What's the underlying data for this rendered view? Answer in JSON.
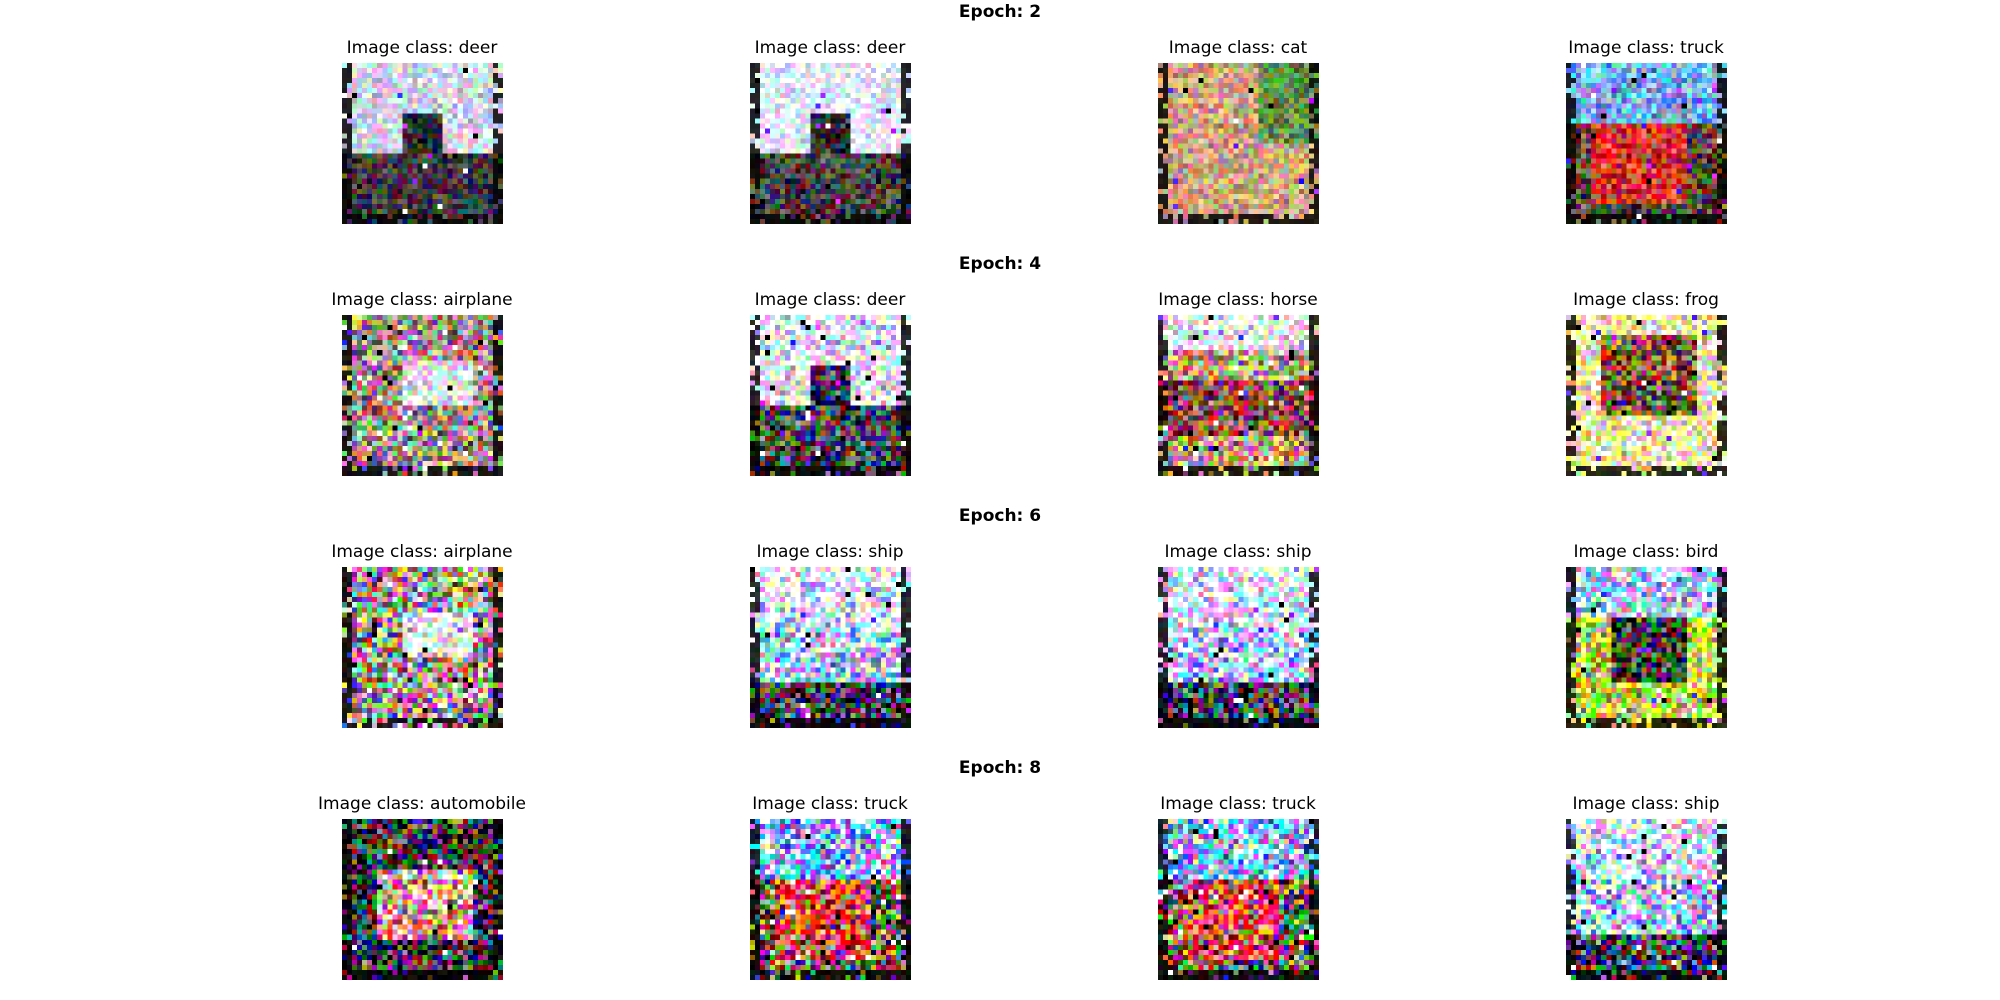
{
  "rows": [
    {
      "title": "Epoch: 2",
      "items": [
        {
          "label": "Image class: deer",
          "scene": "deer",
          "brightness": 0.55,
          "saturation": 0.45
        },
        {
          "label": "Image class: deer",
          "scene": "deer",
          "brightness": 0.7,
          "saturation": 0.45
        },
        {
          "label": "Image class: cat",
          "scene": "cat",
          "brightness": 0.6,
          "saturation": 0.45
        },
        {
          "label": "Image class: truck",
          "scene": "truck",
          "brightness": 0.6,
          "saturation": 0.6
        }
      ]
    },
    {
      "title": "Epoch: 4",
      "items": [
        {
          "label": "Image class: airplane",
          "scene": "airplane",
          "brightness": 0.6,
          "saturation": 0.75
        },
        {
          "label": "Image class: deer",
          "scene": "deer",
          "brightness": 0.75,
          "saturation": 0.75
        },
        {
          "label": "Image class: horse",
          "scene": "horse",
          "brightness": 0.65,
          "saturation": 0.75
        },
        {
          "label": "Image class: frog",
          "scene": "frog",
          "brightness": 0.7,
          "saturation": 0.75
        }
      ]
    },
    {
      "title": "Epoch: 6",
      "items": [
        {
          "label": "Image class: airplane",
          "scene": "airplane",
          "brightness": 0.65,
          "saturation": 0.9
        },
        {
          "label": "Image class: ship",
          "scene": "ship",
          "brightness": 0.75,
          "saturation": 0.9
        },
        {
          "label": "Image class: ship",
          "scene": "ship",
          "brightness": 0.75,
          "saturation": 0.9
        },
        {
          "label": "Image class: bird",
          "scene": "bird",
          "brightness": 0.7,
          "saturation": 0.9
        }
      ]
    },
    {
      "title": "Epoch: 8",
      "items": [
        {
          "label": "Image class: automobile",
          "scene": "automobile",
          "brightness": 0.6,
          "saturation": 1.0
        },
        {
          "label": "Image class: truck",
          "scene": "truck",
          "brightness": 0.75,
          "saturation": 1.0
        },
        {
          "label": "Image class: truck",
          "scene": "truck",
          "brightness": 0.8,
          "saturation": 1.0
        },
        {
          "label": "Image class: ship",
          "scene": "ship",
          "brightness": 0.75,
          "saturation": 1.0
        }
      ]
    }
  ]
}
